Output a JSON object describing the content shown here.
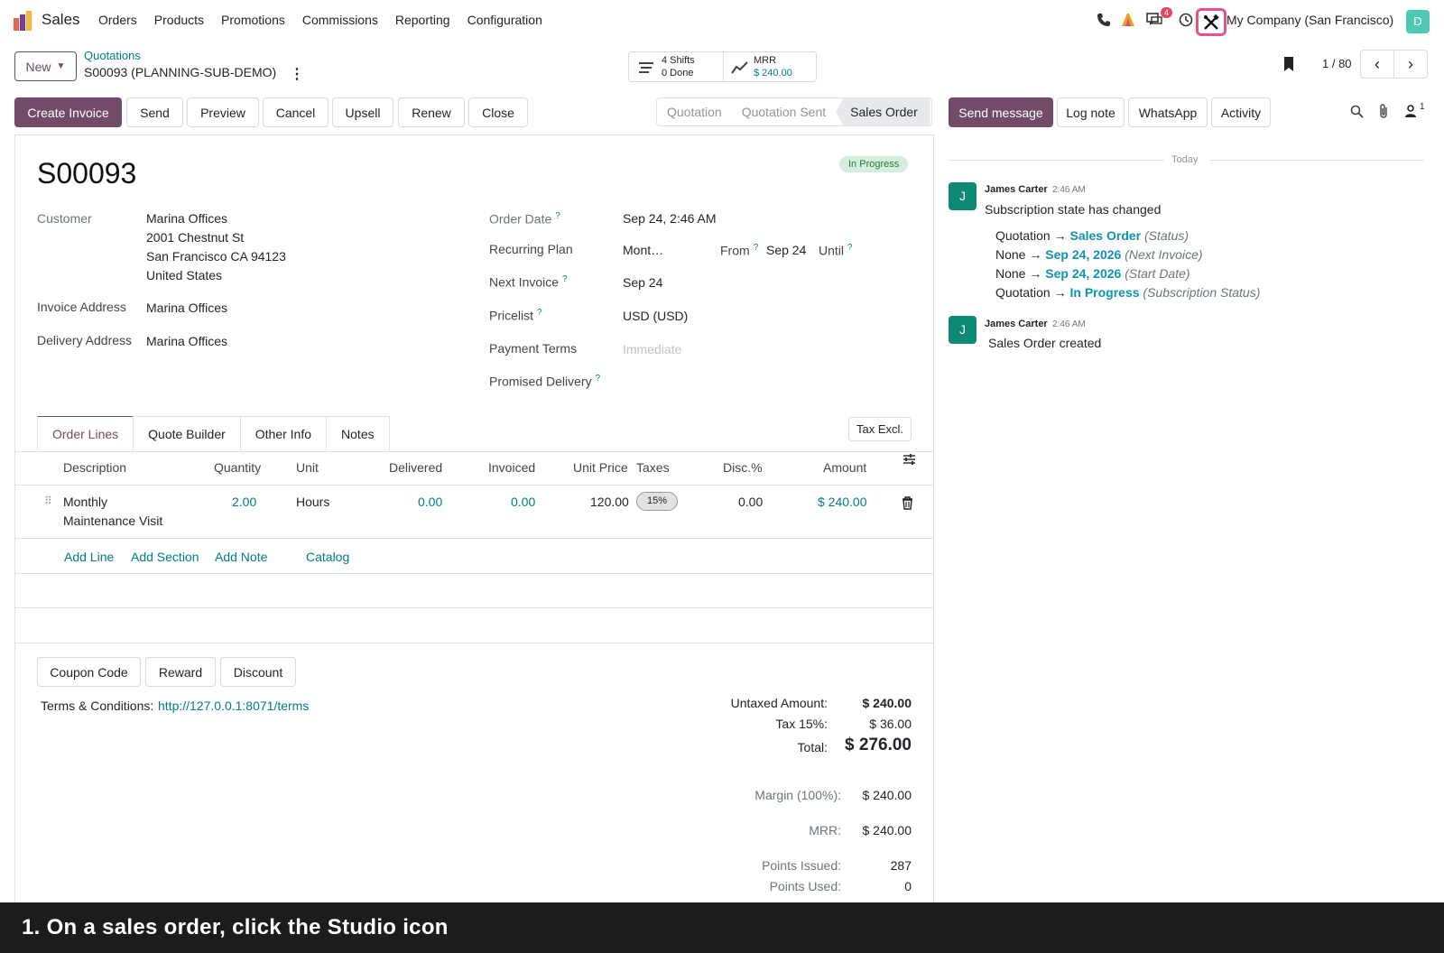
{
  "nav": {
    "app_name": "Sales",
    "menu": [
      "Orders",
      "Products",
      "Promotions",
      "Commissions",
      "Reporting",
      "Configuration"
    ],
    "message_badge": "4",
    "company": "My Company (San Francisco)",
    "avatar_letter": "D"
  },
  "control": {
    "new_label": "New",
    "breadcrumb_parent": "Quotations",
    "breadcrumb_current": "S00093 (PLANNING-SUB-DEMO)",
    "shifts_line1": "4 Shifts",
    "shifts_line2": "0 Done",
    "mrr_line1": "MRR",
    "mrr_line2": "$ 240.00",
    "pager": "1 / 80"
  },
  "actions": {
    "create_invoice": "Create Invoice",
    "send": "Send",
    "preview": "Preview",
    "cancel": "Cancel",
    "upsell": "Upsell",
    "renew": "Renew",
    "close": "Close"
  },
  "statusbar": [
    "Quotation",
    "Quotation Sent",
    "Sales Order"
  ],
  "chatter_buttons": {
    "send_message": "Send message",
    "log_note": "Log note",
    "whatsapp": "WhatsApp",
    "activity": "Activity",
    "followers_count": "1"
  },
  "order": {
    "name": "S00093",
    "ribbon": "In Progress",
    "customer_label": "Customer",
    "customer_name": "Marina Offices",
    "address1": "2001 Chestnut St",
    "address2": "San Francisco CA 94123",
    "address3": "United States",
    "invoice_address_label": "Invoice Address",
    "invoice_address": "Marina Offices",
    "delivery_address_label": "Delivery Address",
    "delivery_address": "Marina Offices",
    "order_date_label": "Order Date",
    "order_date": "Sep 24, 2:46 AM",
    "recurring_plan_label": "Recurring Plan",
    "recurring_plan": "Mont…",
    "from_label": "From",
    "from_value": "Sep 24",
    "until_label": "Until",
    "next_invoice_label": "Next Invoice",
    "next_invoice": "Sep 24",
    "pricelist_label": "Pricelist",
    "pricelist": "USD (USD)",
    "payment_terms_label": "Payment Terms",
    "payment_terms_placeholder": "Immediate",
    "promised_delivery_label": "Promised Delivery"
  },
  "tabs": [
    "Order Lines",
    "Quote Builder",
    "Other Info",
    "Notes"
  ],
  "tax_toggle": "Tax Excl.",
  "lines": {
    "headers": [
      "Description",
      "Quantity",
      "Unit",
      "Delivered",
      "Invoiced",
      "Unit Price",
      "Taxes",
      "Disc.%",
      "Amount"
    ],
    "row": {
      "desc1": "Monthly",
      "desc2": "Maintenance Visit",
      "quantity": "2.00",
      "unit": "Hours",
      "delivered": "0.00",
      "invoiced": "0.00",
      "unit_price": "120.00",
      "taxes": "15%",
      "discount": "0.00",
      "amount": "$ 240.00"
    },
    "add_line": "Add Line",
    "add_section": "Add Section",
    "add_note": "Add Note",
    "catalog": "Catalog"
  },
  "bottom_buttons": {
    "coupon": "Coupon Code",
    "reward": "Reward",
    "discount": "Discount"
  },
  "terms": {
    "label": "Terms & Conditions:",
    "link": "http://127.0.0.1:8071/terms"
  },
  "totals": {
    "untaxed_label": "Untaxed Amount:",
    "untaxed": "$ 240.00",
    "tax_label": "Tax 15%:",
    "tax": "$ 36.00",
    "total_label": "Total:",
    "total": "$ 276.00",
    "margin_label": "Margin (100%):",
    "margin": "$ 240.00",
    "mrr_label": "MRR:",
    "mrr": "$ 240.00",
    "points_issued_label": "Points Issued:",
    "points_issued": "287",
    "points_used_label": "Points Used:",
    "points_used": "0"
  },
  "chatter": {
    "today": "Today",
    "msg1": {
      "avatar": "J",
      "author": "James Carter",
      "time": "2:46 AM",
      "body": "Subscription state has changed",
      "t1_old": "Quotation →",
      "t1_new": "Sales Order",
      "t1_field": "(Status)",
      "t2_old": "None →",
      "t2_new": "Sep 24, 2026",
      "t2_field": "(Next Invoice)",
      "t3_old": "None →",
      "t3_new": "Sep 24, 2026",
      "t3_field": "(Start Date)",
      "t4_old": "Quotation →",
      "t4_new": "In Progress",
      "t4_field": "(Subscription Status)"
    },
    "msg2": {
      "avatar": "J",
      "author": "James Carter",
      "time": "2:46 AM",
      "body": "Sales Order created"
    }
  },
  "caption": "1. On a sales order, click the Studio icon",
  "colors": {
    "brand": "#714b67",
    "link": "#017e84",
    "studio_highlight": "#e8528a",
    "caption_bg": "#1b1c1e"
  }
}
